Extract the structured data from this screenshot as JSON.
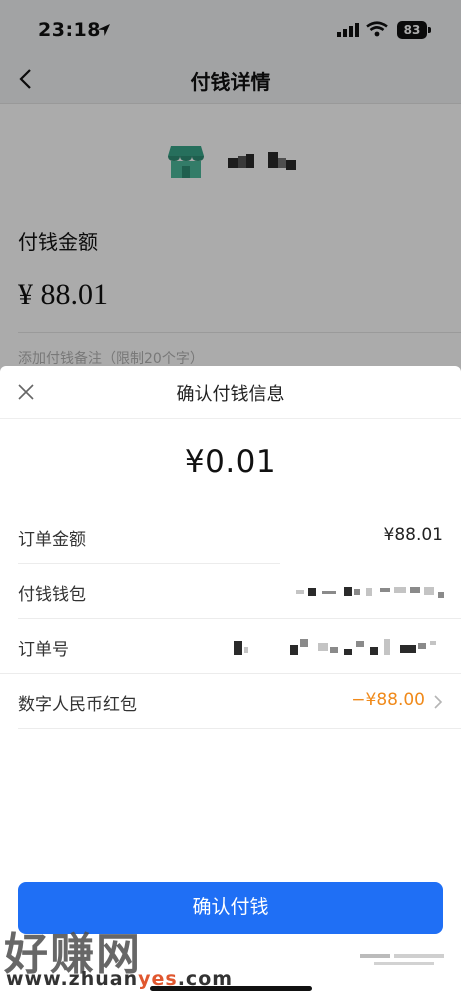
{
  "status_bar": {
    "time": "23:18",
    "battery": "83",
    "icons": [
      "location-arrow-icon",
      "signal-icon",
      "wifi-icon",
      "battery-icon"
    ]
  },
  "nav": {
    "title": "付钱详情",
    "back_icon": "chevron-left-icon"
  },
  "merchant": {
    "icon": "shop-icon",
    "icon_color": "#3aa68a"
  },
  "payment_form": {
    "amount_label": "付钱金额",
    "amount_value": "¥ 88.01",
    "note_placeholder": "添加付钱备注（限制20个字）"
  },
  "confirm_sheet": {
    "title": "确认付钱信息",
    "close_icon": "close-icon",
    "pay_amount": "¥0.01",
    "rows": [
      {
        "label": "订单金额",
        "value": "¥88.01"
      },
      {
        "label": "付钱钱包",
        "value": ""
      },
      {
        "label": "订单号",
        "value": ""
      },
      {
        "label": "数字人民币红包",
        "value": "−¥88.00",
        "value_color": "#f08a1b",
        "icon": "chevron-right-icon"
      }
    ],
    "confirm_button": "确认付钱",
    "button_color": "#1f6ff5"
  },
  "watermark": {
    "main": "好赚网",
    "url_prefix": "www.zhuan",
    "url_accent": "yes",
    "url_suffix": ".com"
  }
}
